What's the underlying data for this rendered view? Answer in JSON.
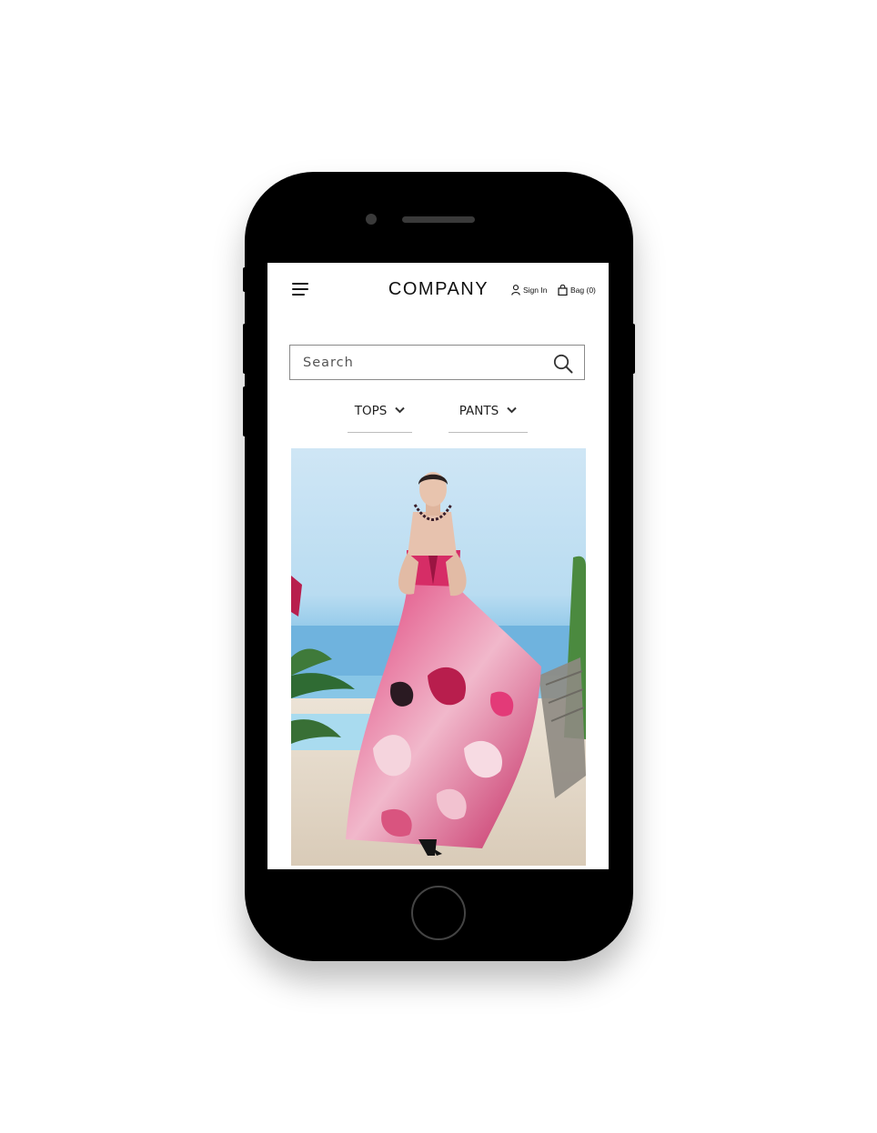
{
  "header": {
    "brand": "COMPANY",
    "sign_in_label": "Sign In",
    "bag_label": "Bag (0)"
  },
  "search": {
    "placeholder": "Search"
  },
  "categories": [
    {
      "label": "TOPS"
    },
    {
      "label": "PANTS"
    }
  ],
  "icons": {
    "menu": "hamburger-icon",
    "account": "user-icon",
    "bag": "shopping-bag-icon",
    "search": "search-icon",
    "dropdown": "chevron-down-icon"
  },
  "colors": {
    "text": "#111111",
    "border": "#8a8a8a",
    "device": "#000000"
  }
}
